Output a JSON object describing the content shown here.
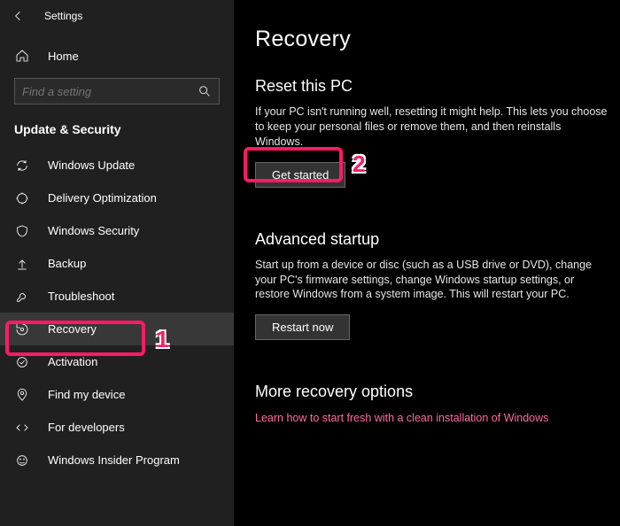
{
  "app_title": "Settings",
  "home_label": "Home",
  "search": {
    "placeholder": "Find a setting"
  },
  "sidebar_section": "Update & Security",
  "nav": [
    {
      "label": "Windows Update"
    },
    {
      "label": "Delivery Optimization"
    },
    {
      "label": "Windows Security"
    },
    {
      "label": "Backup"
    },
    {
      "label": "Troubleshoot"
    },
    {
      "label": "Recovery"
    },
    {
      "label": "Activation"
    },
    {
      "label": "Find my device"
    },
    {
      "label": "For developers"
    },
    {
      "label": "Windows Insider Program"
    }
  ],
  "page": {
    "title": "Recovery",
    "reset": {
      "heading": "Reset this PC",
      "desc": "If your PC isn't running well, resetting it might help. This lets you choose to keep your personal files or remove them, and then reinstalls Windows.",
      "button": "Get started"
    },
    "advanced": {
      "heading": "Advanced startup",
      "desc": "Start up from a device or disc (such as a USB drive or DVD), change your PC's firmware settings, change Windows startup settings, or restore Windows from a system image. This will restart your PC.",
      "button": "Restart now"
    },
    "more": {
      "heading": "More recovery options",
      "link": "Learn how to start fresh with a clean installation of Windows"
    }
  },
  "annotations": {
    "one": "1",
    "two": "2"
  }
}
